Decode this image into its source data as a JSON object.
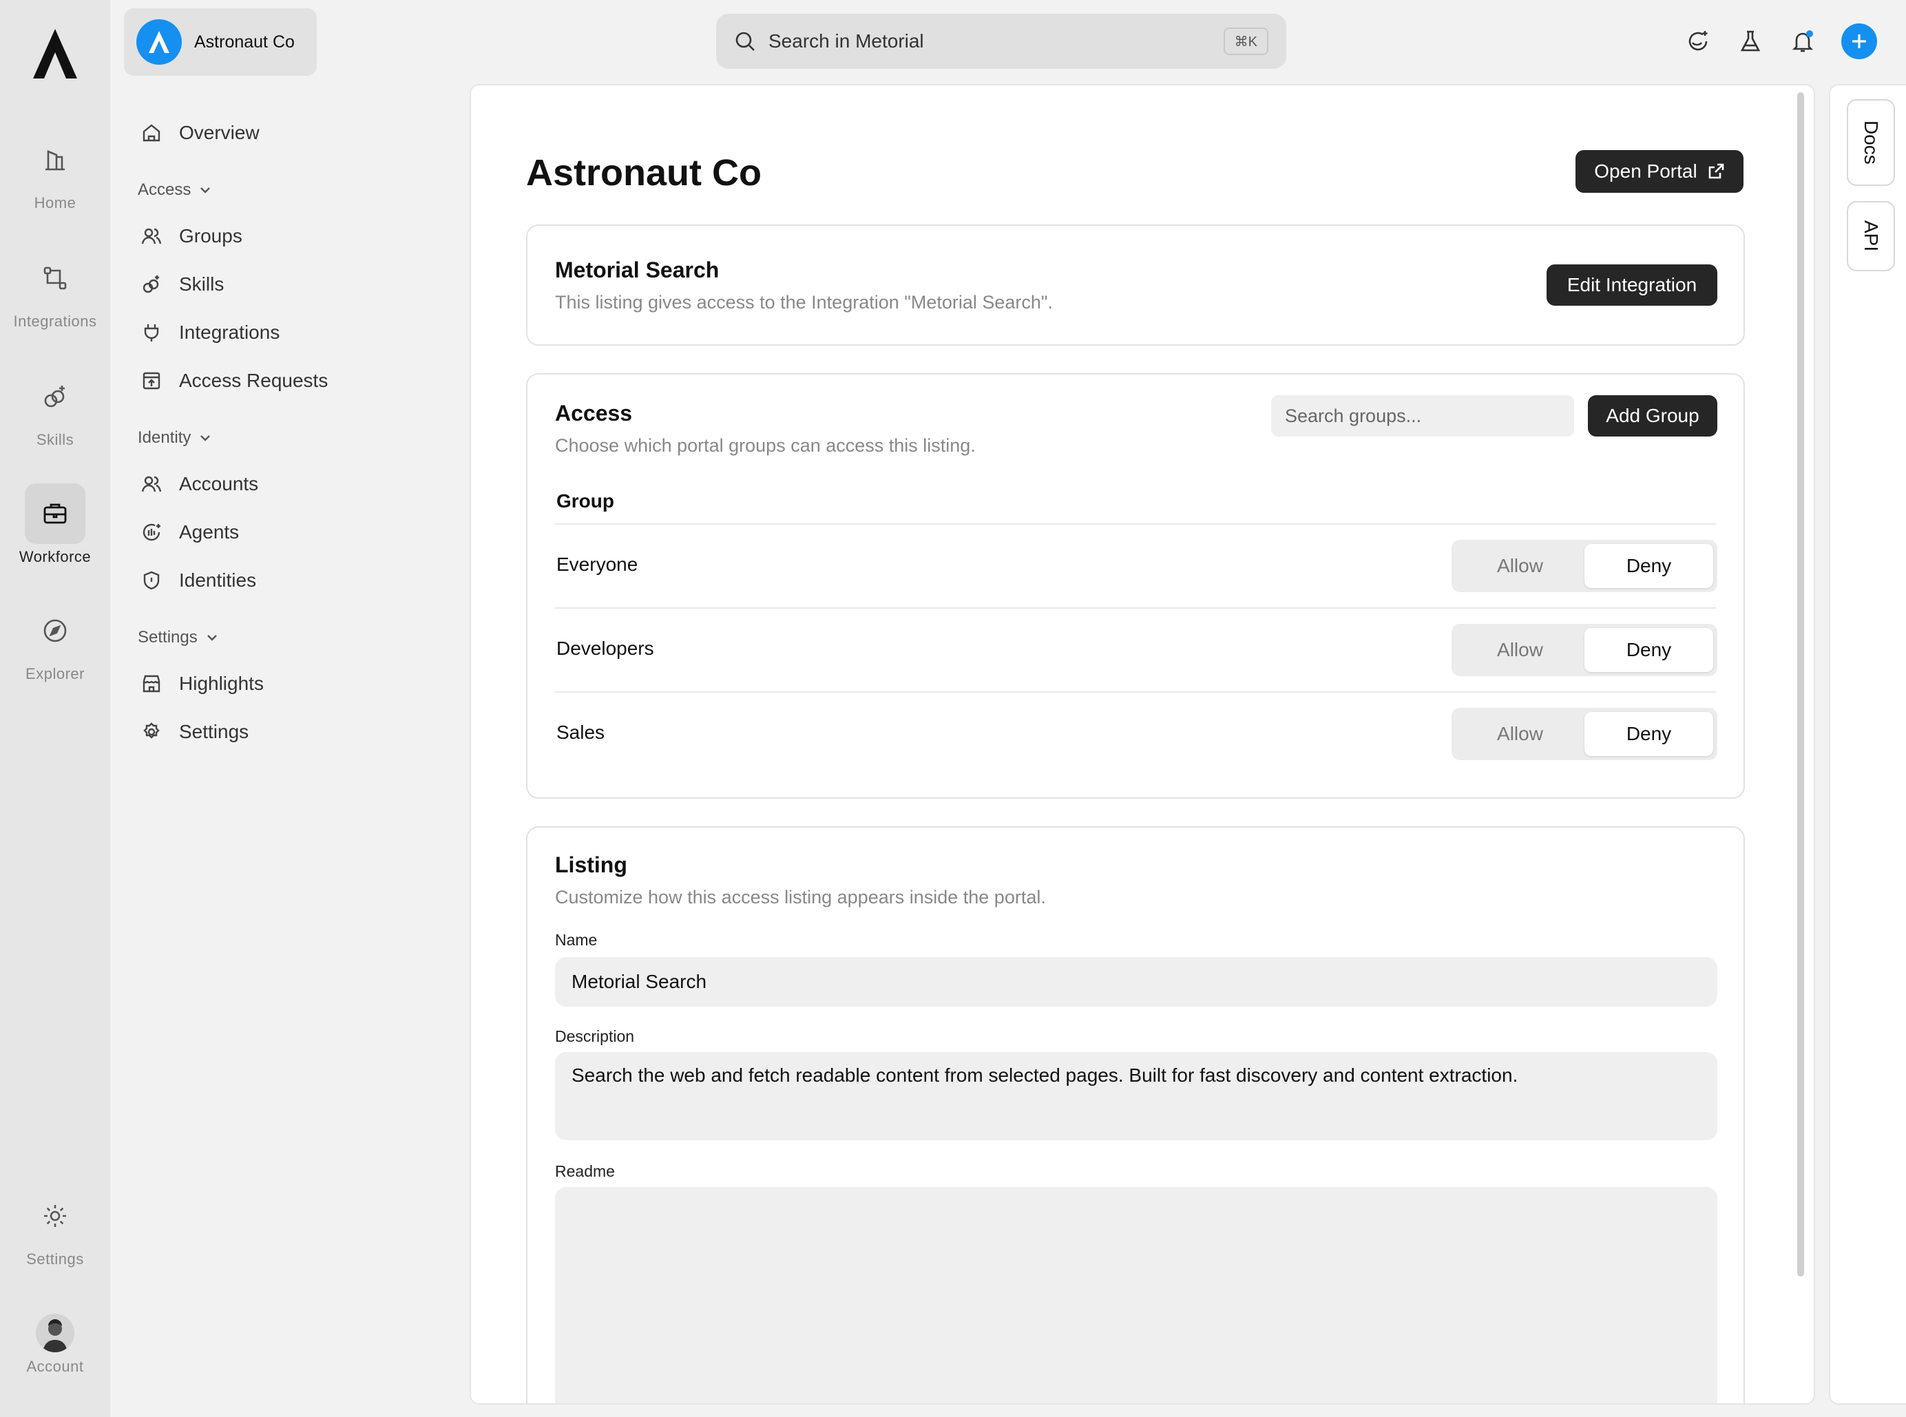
{
  "rail": {
    "items": [
      {
        "label": "Home",
        "icon": "home-building-icon"
      },
      {
        "label": "Integrations",
        "icon": "integrations-icon"
      },
      {
        "label": "Skills",
        "icon": "skills-icon"
      },
      {
        "label": "Workforce",
        "icon": "briefcase-icon"
      },
      {
        "label": "Explorer",
        "icon": "compass-icon"
      },
      {
        "label": "Settings",
        "icon": "gear-icon"
      },
      {
        "label": "Account",
        "icon": "avatar"
      }
    ]
  },
  "org": {
    "name": "Astronaut Co"
  },
  "sidebar": {
    "overview": "Overview",
    "groups": [
      {
        "label": "Access",
        "items": [
          "Groups",
          "Skills",
          "Integrations",
          "Access Requests"
        ]
      },
      {
        "label": "Identity",
        "items": [
          "Accounts",
          "Agents",
          "Identities"
        ]
      },
      {
        "label": "Settings",
        "items": [
          "Highlights",
          "Settings"
        ]
      }
    ]
  },
  "topbar": {
    "search_placeholder": "Search in Metorial",
    "shortcut": "⌘K"
  },
  "colors": {
    "accent": "#1590f0",
    "dark_button": "#262626"
  },
  "main": {
    "title": "Astronaut Co",
    "open_portal": "Open Portal",
    "integration_card": {
      "title": "Metorial Search",
      "subtitle": "This listing gives access to the Integration \"Metorial Search\".",
      "button": "Edit Integration"
    },
    "access_card": {
      "title": "Access",
      "subtitle": "Choose which portal groups can access this listing.",
      "search_placeholder": "Search groups...",
      "add_button": "Add Group",
      "column": "Group",
      "allow_label": "Allow",
      "deny_label": "Deny",
      "rows": [
        {
          "name": "Everyone",
          "selected": "Deny"
        },
        {
          "name": "Developers",
          "selected": "Deny"
        },
        {
          "name": "Sales",
          "selected": "Deny"
        }
      ]
    },
    "listing_card": {
      "title": "Listing",
      "subtitle": "Customize how this access listing appears inside the portal.",
      "name_label": "Name",
      "name_value": "Metorial Search",
      "description_label": "Description",
      "description_value": "Search the web and fetch readable content from selected pages. Built for fast discovery and content extraction.",
      "readme_label": "Readme",
      "readme_value": ""
    }
  },
  "dock": {
    "docs": "Docs",
    "api": "API"
  }
}
